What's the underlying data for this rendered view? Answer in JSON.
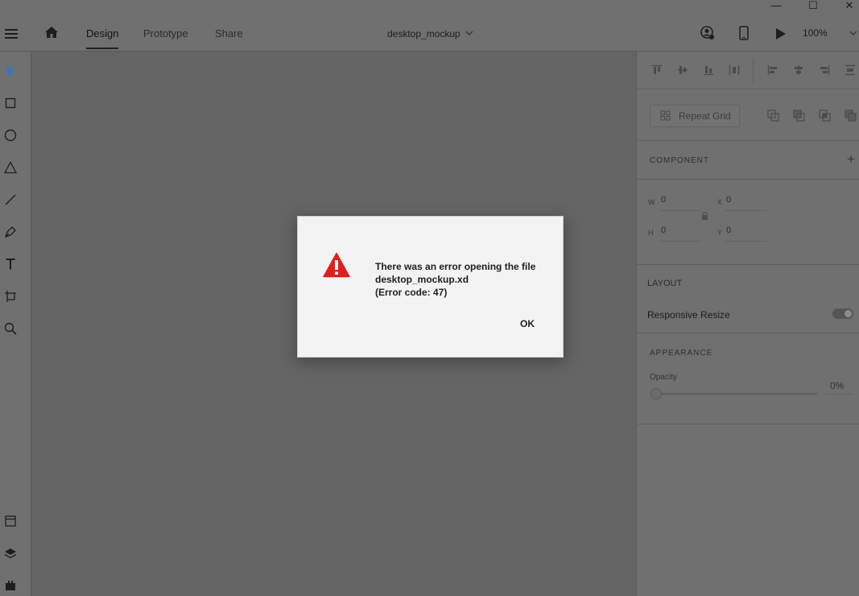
{
  "window": {
    "minimize": "—",
    "maximize": "☐",
    "close": "✕"
  },
  "menubar": {
    "tabs": [
      {
        "label": "Design",
        "active": true
      },
      {
        "label": "Prototype",
        "active": false
      },
      {
        "label": "Share",
        "active": false
      }
    ],
    "document_title": "desktop_mockup",
    "zoom": "100%"
  },
  "toolbar": {
    "tools": [
      "select-icon",
      "rectangle-icon",
      "ellipse-icon",
      "polygon-icon",
      "line-icon",
      "pen-icon",
      "text-icon",
      "artboard-icon",
      "zoom-icon"
    ],
    "bottom": [
      "assets-icon",
      "layers-icon",
      "plugins-icon"
    ]
  },
  "panel": {
    "repeat_grid": "Repeat Grid",
    "component_title": "COMPONENT",
    "component_add": "+",
    "fields": {
      "w_label": "W",
      "w_value": "0",
      "h_label": "H",
      "h_value": "0",
      "x_label": "X",
      "x_value": "0",
      "y_label": "Y",
      "y_value": "0"
    },
    "layout_title": "LAYOUT",
    "responsive_resize": "Responsive Resize",
    "responsive_resize_on": true,
    "appearance_title": "APPEARANCE",
    "opacity_label": "Opacity",
    "opacity_value": "0%"
  },
  "dialog": {
    "line1": "There was an error opening the file",
    "line2": "desktop_mockup.xd",
    "line3": "(Error code: 47)",
    "ok_label": "OK",
    "icon": "warning-icon",
    "icon_color": "#e01e1e"
  }
}
